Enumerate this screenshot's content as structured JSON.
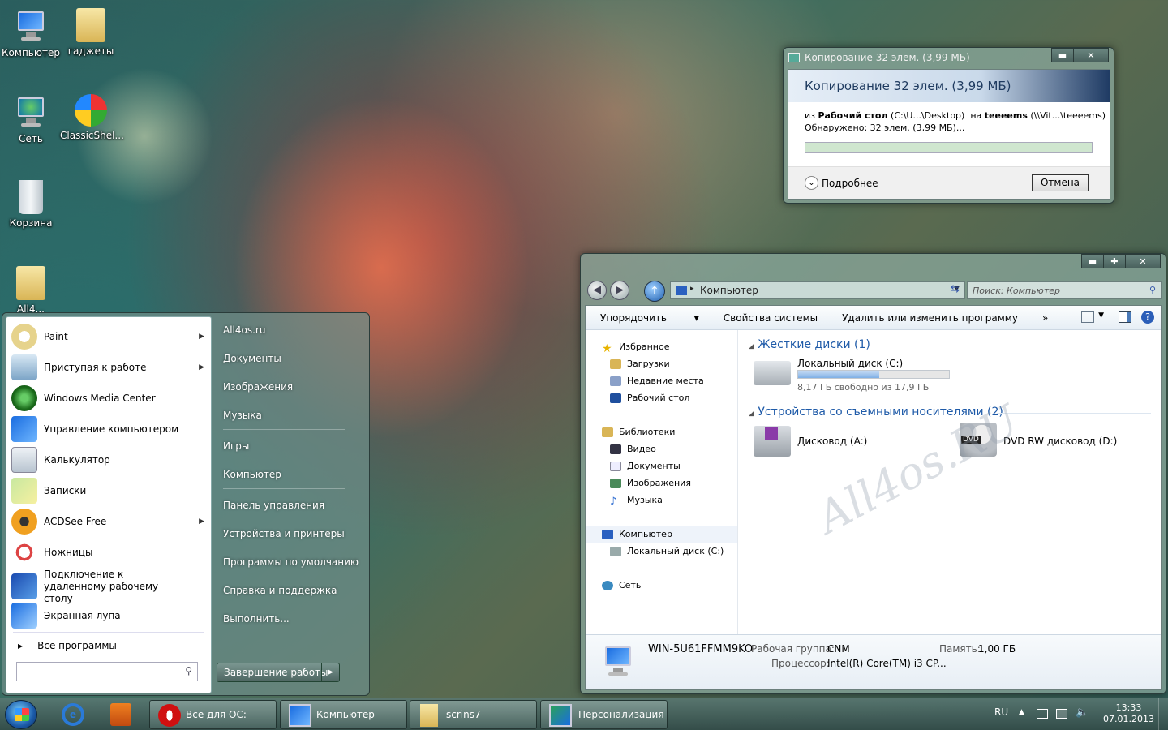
{
  "desktop": {
    "icons": [
      {
        "label": "Компьютер"
      },
      {
        "label": "гаджеты"
      },
      {
        "label": "Сеть"
      },
      {
        "label": "ClassicShel..."
      },
      {
        "label": "Корзина"
      },
      {
        "label": "All4..."
      }
    ],
    "watermark": "All4os.RU"
  },
  "copy_dialog": {
    "title": "Копирование 32 элем. (3,99 МБ)",
    "header": "Копирование 32 элем. (3,99 МБ)",
    "from_prefix": "из",
    "from_name": "Рабочий стол",
    "from_path": "(C:\\U...\\Desktop)",
    "to_prefix": "на",
    "to_name": "teeeems",
    "to_path": "(\\\\Vit...\\teeeems)",
    "found": "Обнаружено: 32 элем. (3,99 МБ)...",
    "more_label": "Подробнее",
    "cancel_label": "Отмена",
    "progress_percent": 0,
    "minimize": "▬",
    "close": "✕"
  },
  "explorer": {
    "address": "Компьютер",
    "search_placeholder": "Поиск: Компьютер",
    "toolbar": {
      "organize": "Упорядочить",
      "system_props": "Свойства системы",
      "uninstall": "Удалить или изменить программу",
      "more": "»"
    },
    "nav": {
      "favorites": "Избранное",
      "downloads": "Загрузки",
      "recent": "Недавние места",
      "desktop": "Рабочий стол",
      "libraries": "Библиотеки",
      "video": "Видео",
      "documents": "Документы",
      "images": "Изображения",
      "music": "Музыка",
      "computer": "Компьютер",
      "local_disk": "Локальный диск (C:)",
      "network": "Сеть"
    },
    "groups": {
      "hard_disks": "Жесткие диски (1)",
      "removable": "Устройства со съемными носителями (2)"
    },
    "drives": {
      "c_name": "Локальный диск (C:)",
      "c_free": "8,17 ГБ свободно из 17,9 ГБ",
      "c_used_fraction": 0.54,
      "a_name": "Дисковод (A:)",
      "d_name": "DVD RW дисковод (D:)",
      "dvd_badge": "DVD"
    },
    "details": {
      "pc_name": "WIN-5U61FFMM9KO",
      "workgroup_label": "Рабочая группа:",
      "workgroup": "CNM",
      "memory_label": "Память:",
      "memory": "1,00 ГБ",
      "cpu_label": "Процессор:",
      "cpu": "Intel(R) Core(TM) i3 CP..."
    },
    "win": {
      "min": "▬",
      "max": "✚",
      "close": "✕"
    }
  },
  "start_menu": {
    "left_items": [
      {
        "label": "Paint",
        "arrow": "▶"
      },
      {
        "label": "Приступая к работе",
        "arrow": "▶"
      },
      {
        "label": "Windows Media Center"
      },
      {
        "label": "Управление компьютером"
      },
      {
        "label": "Калькулятор"
      },
      {
        "label": "Записки"
      },
      {
        "label": "ACDSee Free",
        "arrow": "▶"
      },
      {
        "label": "Ножницы"
      },
      {
        "label": "Подключение к удаленному рабочему столу"
      },
      {
        "label": "Экранная лупа"
      }
    ],
    "all_programs": "Все программы",
    "all_programs_arrow": "▶",
    "right_items": [
      "All4os.ru",
      "Документы",
      "Изображения",
      "Музыка",
      "Игры",
      "Компьютер",
      "Панель управления",
      "Устройства и принтеры",
      "Программы по умолчанию",
      "Справка и поддержка",
      "Выполнить..."
    ],
    "shutdown": "Завершение работы",
    "shutdown_arrow": "▶"
  },
  "taskbar": {
    "buttons": [
      {
        "label": "Все для ОС: наст..."
      },
      {
        "label": "Компьютер"
      },
      {
        "label": "scrins7"
      },
      {
        "label": "Персонализация"
      }
    ],
    "lang": "RU",
    "time": "13:33",
    "date": "07.01.2013"
  }
}
